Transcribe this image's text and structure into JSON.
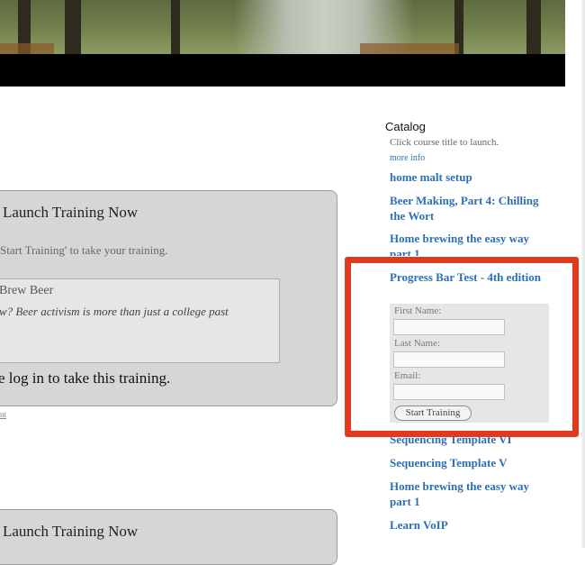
{
  "panels": [
    {
      "title": "Launch Training Now",
      "subtitle": "Start Training' to take your training.",
      "course_name": "Brew Beer",
      "course_desc": "w? Beer activism is more than just a college past",
      "login_msg": "e log in to take this training."
    },
    {
      "title": "Launch Training Now"
    }
  ],
  "small_link": "nt",
  "sidebar": {
    "heading": "Catalog",
    "help": "Click course title to launch.",
    "more_info": "more info",
    "courses": [
      "home malt setup",
      "Beer Making, Part 4: Chilling the Wort",
      "Home brewing the easy way part 1",
      "Progress Bar Test - 4th edition",
      "Sequencing Template VI",
      "Sequencing Template V",
      "Home brewing the easy way part 1",
      "Learn VoIP"
    ],
    "form": {
      "first_name_label": "First Name:",
      "last_name_label": "Last Name:",
      "email_label": "Email:",
      "first_name_value": "",
      "last_name_value": "",
      "email_value": "",
      "start_button": "Start Training"
    }
  },
  "colors": {
    "link": "#2c6fb6",
    "highlight": "#e0391c",
    "panel": "#d6d6d6"
  }
}
